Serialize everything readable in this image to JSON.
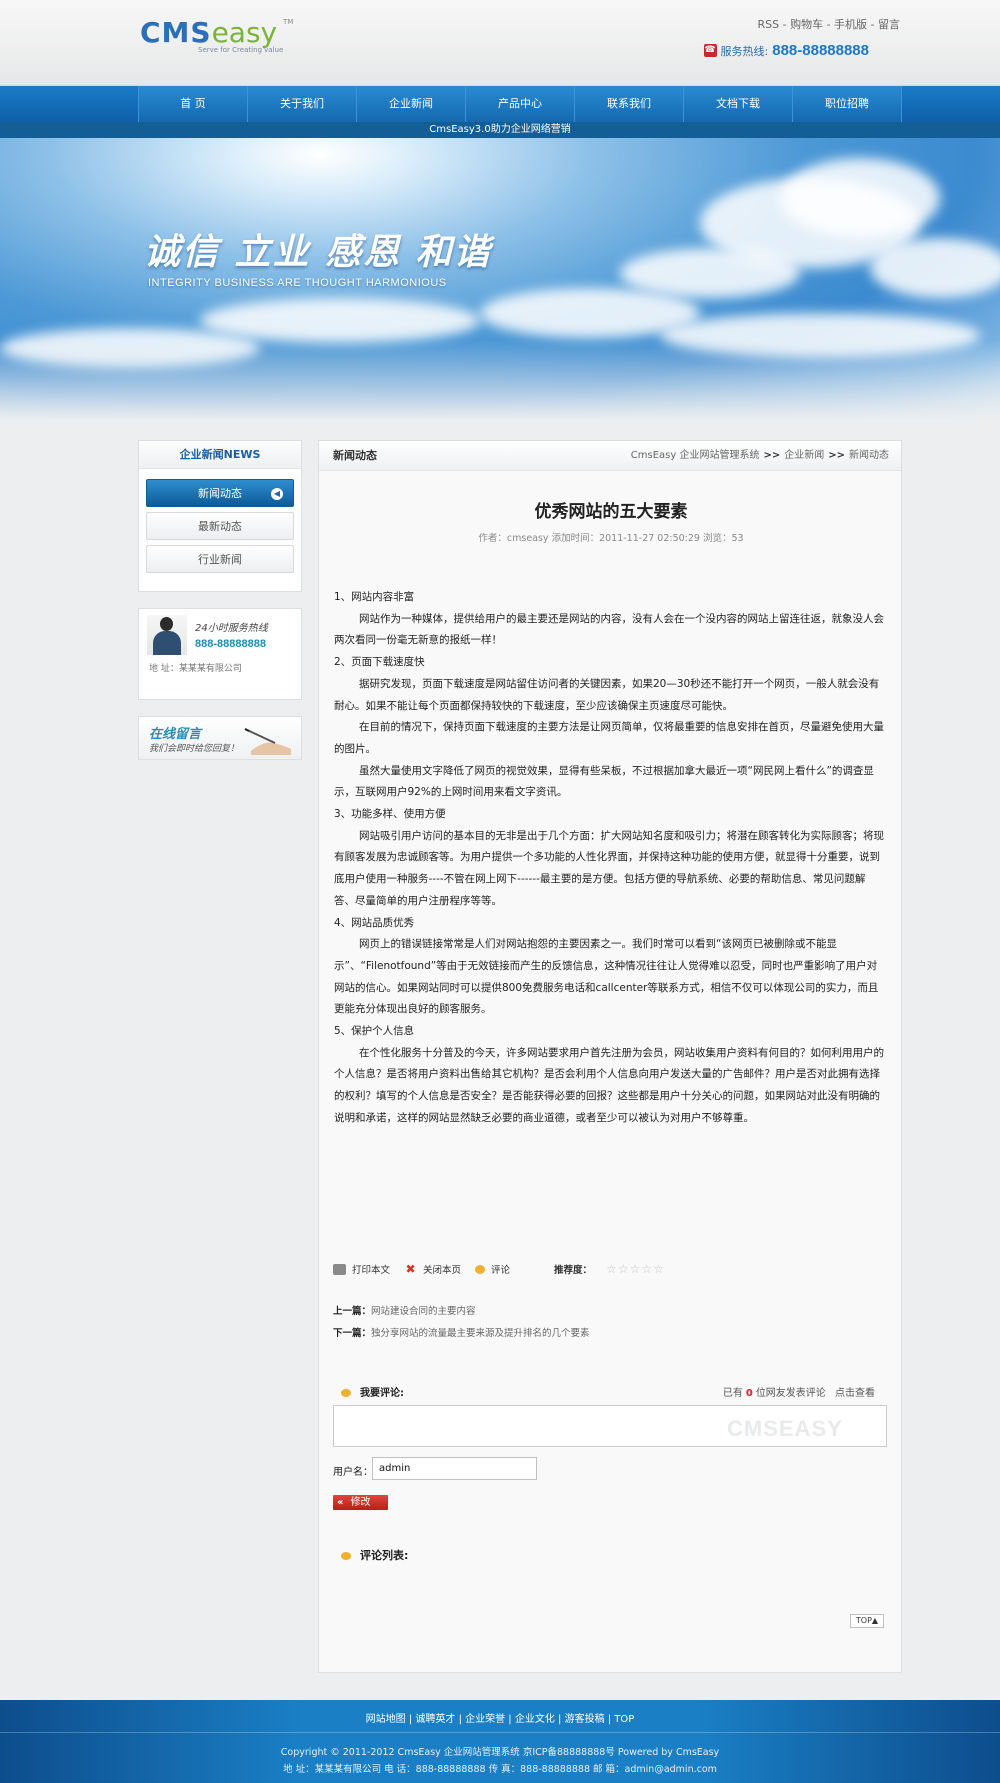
{
  "header": {
    "logo_text_1": "CMS",
    "logo_text_2": "easy",
    "logo_tm": "TM",
    "logo_tagline": "Serve for Creating value",
    "top_links": "RSS - 购物车 - 手机版 - 留言",
    "hotline_label": "服务热线:",
    "hotline_number": "888-88888888"
  },
  "nav": [
    "首 页",
    "关于我们",
    "企业新闻",
    "产品中心",
    "联系我们",
    "文档下载",
    "职位招聘"
  ],
  "subnav": "CmsEasy3.0助力企业网络营销",
  "banner": {
    "slogan": "诚信 立业 感恩 和谐",
    "slogan_en": "INTEGRITY BUSINESS ARE THOUGHT HARMONIOUS"
  },
  "sidebar": {
    "title": "企业新闻NEWS",
    "items": [
      {
        "label": "新闻动态",
        "active": true
      },
      {
        "label": "最新动态",
        "active": false
      },
      {
        "label": "行业新闻",
        "active": false
      }
    ],
    "service_label": "24小时服务热线",
    "service_number": "888-88888888",
    "address": "地 址：某某某有限公司",
    "message_title": "在线留言",
    "message_sub": "我们会即时给您回复！"
  },
  "main": {
    "section_label": "新闻动态",
    "breadcrumb": [
      "CmsEasy 企业网站管理系统",
      "企业新闻",
      "新闻动态"
    ],
    "breadcrumb_sep": ">>",
    "article": {
      "title": "优秀网站的五大要素",
      "meta": "作者：cmseasy  添加时间：2011-11-27 02:50:29  浏览：53",
      "paragraphs": [
        {
          "text": "1、网站内容非富",
          "indent": false
        },
        {
          "text": "网站作为一种媒体，提供给用户的最主要还是网站的内容，没有人会在一个没内容的网站上留连往返，就象没人会两次看同一份毫无新意的报纸一样！",
          "indent": true
        },
        {
          "text": "2、页面下载速度快",
          "indent": false
        },
        {
          "text": "据研究发现，页面下载速度是网站留住访问者的关键因素，如果20—30秒还不能打开一个网页，一般人就会没有耐心。如果不能让每个页面都保持较快的下载速度，至少应该确保主页速度尽可能快。",
          "indent": true
        },
        {
          "text": "在目前的情况下，保持页面下载速度的主要方法是让网页简单，仅将最重要的信息安排在首页，尽量避免使用大量的图片。",
          "indent": true
        },
        {
          "text": "虽然大量使用文字降低了网页的视觉效果，显得有些呆板，不过根据加拿大最近一项“网民网上看什么”的调查显示，互联网用户92%的上网时间用来看文字资讯。",
          "indent": true
        },
        {
          "text": "3、功能多样、使用方便",
          "indent": false
        },
        {
          "text": "网站吸引用户访问的基本目的无非是出于几个方面：扩大网站知名度和吸引力；将潜在顾客转化为实际顾客；将现有顾客发展为忠诚顾客等。为用户提供一个多功能的人性化界面，并保持这种功能的使用方便，就显得十分重要，说到底用户使用一种服务----不管在网上网下------最主要的是方便。包括方便的导航系统、必要的帮助信息、常见问题解答、尽量简单的用户注册程序等等。",
          "indent": true
        },
        {
          "text": "4、网站品质优秀",
          "indent": false
        },
        {
          "text": "网页上的错误链接常常是人们对网站抱怨的主要因素之一。我们时常可以看到“该网页已被删除或不能显示”、“Filenotfound”等由于无效链接而产生的反馈信息，这种情况往往让人觉得难以忍受，同时也严重影响了用户对网站的信心。如果网站同时可以提供800免费服务电话和callcenter等联系方式，相信不仅可以体现公司的实力，而且更能充分体现出良好的顾客服务。",
          "indent": true
        },
        {
          "text": "5、保护个人信息",
          "indent": false
        },
        {
          "text": "在个性化服务十分普及的今天，许多网站要求用户首先注册为会员，网站收集用户资料有何目的？如何利用用户的个人信息？是否将用户资料出售给其它机构？是否会利用个人信息向用户发送大量的广告邮件？用户是否对此拥有选择的权利？填写的个人信息是否安全？是否能获得必要的回报？这些都是用户十分关心的问题，如果网站对此没有明确的说明和承诺，这样的网站显然缺乏必要的商业道德，或者至少可以被认为对用户不够尊重。",
          "indent": true
        }
      ]
    },
    "tools": {
      "print": "打印本文",
      "close": "关闭本页",
      "comment": "评论",
      "rating_label": "推荐度：",
      "stars": "☆☆☆☆☆",
      "rating_value": 0,
      "rating_max": 5
    },
    "prev": {
      "label": "上一篇：",
      "title": "网站建设合同的主要内容"
    },
    "next": {
      "label": "下一篇：",
      "title": "独分享网站的流量最主要来源及提升排名的几个要素"
    },
    "comment_form": {
      "title": "我要评论:",
      "count_prefix": "已有",
      "count": "0",
      "count_suffix": "位网友发表评论",
      "view_link": "点击查看",
      "textarea_value": "",
      "watermark": "CMSEASY",
      "user_label": "用户名：",
      "user_value": "admin",
      "submit_label": "修改",
      "submit_prefix": "«"
    },
    "comment_list_title": "评论列表:",
    "top_button": "TOP▲"
  },
  "footer": {
    "links": "网站地图 | 诚聘英才 | 企业荣誉 | 企业文化 | 游客投稿 | TOP",
    "copyright": "Copyright © 2011-2012  CmsEasy 企业网站管理系统  京ICP备88888888号  Powered by CmsEasy",
    "address": "地 址：某某某有限公司  电 话：888-88888888  传 真：888-88888888  邮 箱：admin@admin.com"
  },
  "colors": {
    "nav_blue": "#1469b0",
    "accent_blue": "#1e78c2",
    "sidebar_active": "#0e5a97",
    "submit_red": "#c8282d",
    "comment_bullet": "#f0b132"
  }
}
